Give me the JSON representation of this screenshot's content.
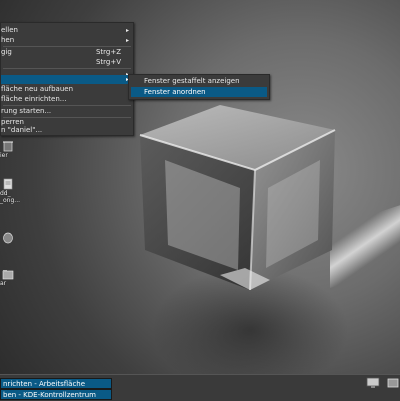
{
  "menu": {
    "items": [
      {
        "label": "ellen",
        "shortcut": "",
        "submenu": true
      },
      {
        "label": "hen",
        "shortcut": "",
        "submenu": true
      },
      {
        "label": "gig",
        "shortcut": "Strg+Z",
        "submenu": false
      },
      {
        "label": "",
        "shortcut": "Strg+V",
        "submenu": false
      },
      {
        "label": "",
        "shortcut": "",
        "submenu": true
      },
      {
        "label": "",
        "shortcut": "",
        "submenu": true,
        "selected": true
      },
      {
        "label": "fläche neu aufbauen",
        "shortcut": "",
        "submenu": false
      },
      {
        "label": "fläche einrichten...",
        "shortcut": "",
        "submenu": false
      },
      {
        "label": "rung starten...",
        "shortcut": "",
        "submenu": false
      },
      {
        "label": "perren",
        "shortcut": "",
        "submenu": false
      },
      {
        "label": "n \"daniel\"...",
        "shortcut": "",
        "submenu": false
      }
    ]
  },
  "submenu": {
    "items": [
      {
        "label": "Fenster gestaffelt anzeigen",
        "selected": false
      },
      {
        "label": "Fenster anordnen",
        "selected": true
      }
    ]
  },
  "desktop_icons": [
    {
      "label": "ier",
      "icon": "trash-icon"
    },
    {
      "label": "dd_",
      "label2": "_ong...",
      "icon": "document-icon"
    },
    {
      "label": "",
      "icon": "drive-icon"
    },
    {
      "label": "ar",
      "icon": "folder-icon"
    }
  ],
  "taskbar": {
    "tasks": [
      {
        "label": "nrichten - Arbeitsfläche"
      },
      {
        "label": "ben - KDE-Kontrollzentrum"
      }
    ]
  },
  "colors": {
    "selection": "#0a5a86",
    "menu_bg": "#3b3b3b"
  }
}
